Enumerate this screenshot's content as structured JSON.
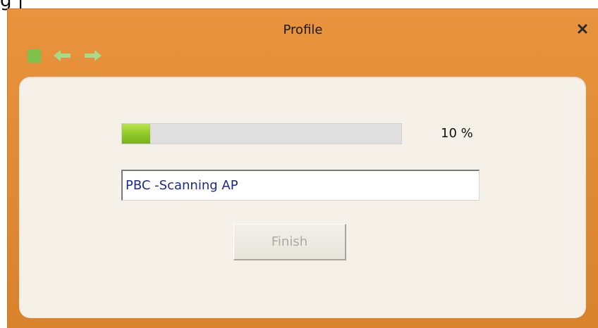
{
  "clipped_text": "g |",
  "window": {
    "title": "Profile",
    "close_glyph": "×"
  },
  "nav": {
    "icons": [
      "stop-square-icon",
      "back-arrow-icon",
      "forward-arrow-icon"
    ]
  },
  "progress": {
    "value_percent": 10,
    "label": "10 %"
  },
  "status": {
    "value": "PBC -Scanning AP"
  },
  "buttons": {
    "finish_label": "Finish",
    "finish_enabled": false
  },
  "colors": {
    "window_orange": "#e08a33",
    "panel_cream": "#f5f1e8",
    "progress_green": "#8fc92a",
    "status_text_blue": "#1b2a8c",
    "nav_green": "#7ec14a"
  }
}
